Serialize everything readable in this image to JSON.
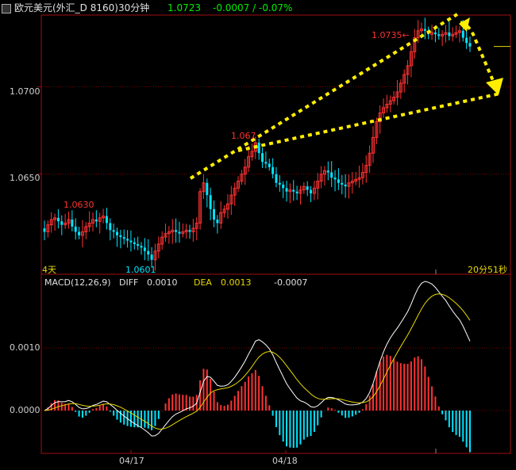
{
  "header": {
    "title": "欧元美元(外汇_D 8160)30分钟",
    "price": "1.0723",
    "change": "-0.0007 / -0.07%"
  },
  "main_axis": {
    "ticks": [
      "1.0700",
      "1.0650"
    ],
    "period_label": "4天",
    "countdown": "20分51秒"
  },
  "annotations": {
    "high_label": "1.0735",
    "high_arrow": "←",
    "mid_high_label": "1.067",
    "early_high_label": "1.0630",
    "low_label": "1.0601"
  },
  "macd": {
    "title": "MACD(12,26,9)",
    "diff_label": "DIFF",
    "diff_value": "0.0010",
    "dea_label": "DEA",
    "dea_value": "0.0013",
    "macd_value": "-0.0007",
    "ticks": [
      "0.0010",
      "0.0000"
    ]
  },
  "dates": [
    "04/17",
    "04/18"
  ],
  "colors": {
    "up": "#ff3232",
    "down": "#00e4ff",
    "grid": "#7a0000",
    "frame": "#a01010",
    "diff_line": "#ffffff",
    "dea_line": "#e8d800",
    "arrow": "#ffee00",
    "title_white": "#e0e0e0",
    "price_green": "#00ee00",
    "macd_yellow": "#e8d800"
  },
  "chart_data": {
    "type": "candlestick",
    "symbol": "欧元美元",
    "interval": "30分钟",
    "ylim": [
      1.06,
      1.0736
    ],
    "series_close": [
      1.0617,
      1.0621,
      1.0624,
      1.0625,
      1.0623,
      1.0621,
      1.0622,
      1.0624,
      1.062,
      1.0617,
      1.0615,
      1.0617,
      1.062,
      1.0622,
      1.0624,
      1.0623,
      1.0625,
      1.0626,
      1.0622,
      1.0618,
      1.0617,
      1.0615,
      1.0614,
      1.0613,
      1.0612,
      1.0611,
      1.061,
      1.0609,
      1.0608,
      1.0606,
      1.0604,
      1.0601,
      1.0606,
      1.061,
      1.0614,
      1.0616,
      1.0617,
      1.0618,
      1.0617,
      1.0616,
      1.0617,
      1.0618,
      1.0617,
      1.0619,
      1.0622,
      1.064,
      1.0645,
      1.0638,
      1.063,
      1.0624,
      1.0622,
      1.0628,
      1.063,
      1.0633,
      1.0638,
      1.0642,
      1.0646,
      1.065,
      1.0654,
      1.066,
      1.0663,
      1.0668,
      1.0662,
      1.0657,
      1.0656,
      1.0654,
      1.065,
      1.0645,
      1.0644,
      1.0642,
      1.064,
      1.0641,
      1.064,
      1.0639,
      1.0641,
      1.0643,
      1.0641,
      1.0639,
      1.0642,
      1.0646,
      1.065,
      1.0652,
      1.0651,
      1.0648,
      1.0647,
      1.0645,
      1.0644,
      1.0643,
      1.0645,
      1.0646,
      1.0647,
      1.0648,
      1.0651,
      1.0655,
      1.0662,
      1.0671,
      1.068,
      1.0685,
      1.0688,
      1.069,
      1.0692,
      1.0694,
      1.0697,
      1.0702,
      1.0707,
      1.0712,
      1.072,
      1.0728,
      1.0732,
      1.0733,
      1.0732,
      1.073,
      1.0731,
      1.073,
      1.0729,
      1.073,
      1.0731,
      1.0729,
      1.073,
      1.0731,
      1.0732,
      1.0728,
      1.0725,
      1.0723
    ],
    "macd_close_hist": "derived"
  }
}
